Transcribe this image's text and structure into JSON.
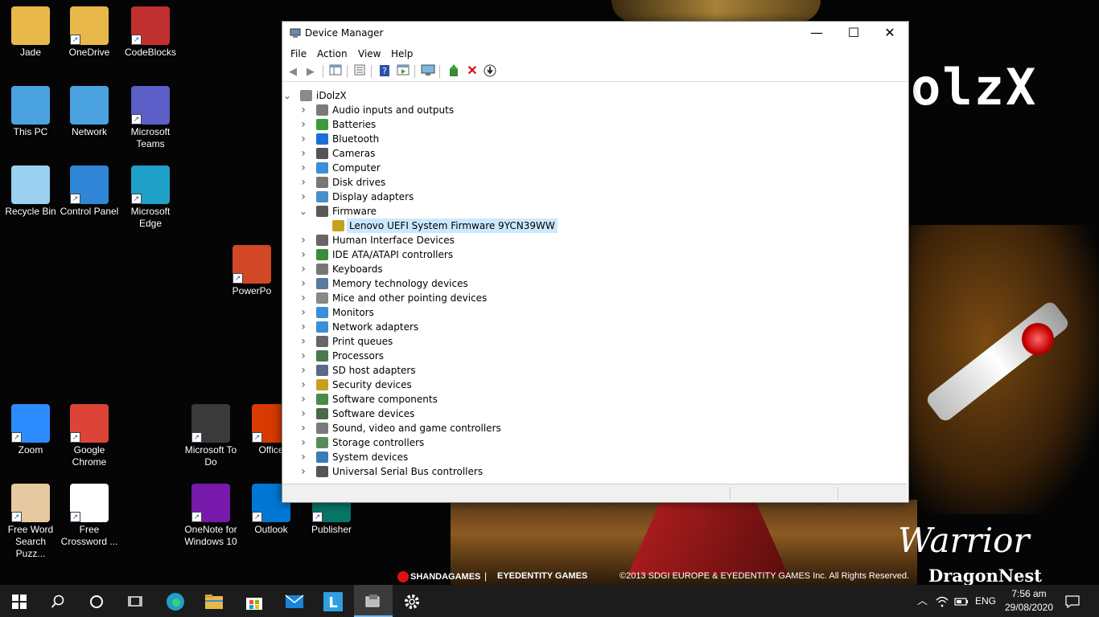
{
  "wallpaper": {
    "title": "olzX",
    "warrior": "Warrior",
    "dragonnest": "DragonNest",
    "copyright": "©2013 SDGI EUROPE & EYEDENTITY GAMES Inc. All Rights Reserved.",
    "shanda": "SHANDAGAMES",
    "separator": "|",
    "eyedentity": "EYEDENTITY GAMES"
  },
  "desktop_icons": [
    {
      "label": "Jade",
      "icon": "user-folder-icon",
      "color": "#e8b84a"
    },
    {
      "label": "OneDrive",
      "icon": "onedrive-icon",
      "color": "#e8b84a"
    },
    {
      "label": "CodeBlocks",
      "icon": "codeblocks-icon",
      "color": "#c03030"
    },
    {
      "label": "This PC",
      "icon": "this-pc-icon",
      "color": "#4aa3df"
    },
    {
      "label": "Network",
      "icon": "network-icon",
      "color": "#4aa3df"
    },
    {
      "label": "Microsoft Teams",
      "icon": "teams-icon",
      "color": "#5b5fc7"
    },
    {
      "label": "Recycle Bin",
      "icon": "recycle-bin-icon",
      "color": "#9ad0f0"
    },
    {
      "label": "Control Panel",
      "icon": "control-panel-icon",
      "color": "#2f86d6"
    },
    {
      "label": "Microsoft Edge",
      "icon": "edge-icon",
      "color": "#1fa0c8"
    },
    {
      "label": "PowerPo",
      "icon": "powerpoint-icon",
      "color": "#d24726"
    },
    {
      "label": "Zoom",
      "icon": "zoom-icon",
      "color": "#2d8cff"
    },
    {
      "label": "Google Chrome",
      "icon": "chrome-icon",
      "color": "#db4437"
    },
    {
      "label": "Microsoft To Do",
      "icon": "todo-icon",
      "color": "#3a3a3a"
    },
    {
      "label": "Office",
      "icon": "office-icon",
      "color": "#d83b01"
    },
    {
      "label": "Free Word Search Puzz...",
      "icon": "word-search-icon",
      "color": "#e6c9a0"
    },
    {
      "label": "Free Crossword ...",
      "icon": "crossword-icon",
      "color": "#ffffff"
    },
    {
      "label": "OneNote for Windows 10",
      "icon": "onenote-icon",
      "color": "#7719aa"
    },
    {
      "label": "Outlook",
      "icon": "outlook-icon",
      "color": "#0078d4"
    },
    {
      "label": "Publisher",
      "icon": "publisher-icon",
      "color": "#077568"
    }
  ],
  "window": {
    "title": "Device Manager",
    "minimize": "—",
    "maximize": "☐",
    "close": "✕",
    "menu": [
      "File",
      "Action",
      "View",
      "Help"
    ],
    "toolbar_icons": [
      "back-arrow-icon",
      "forward-arrow-icon",
      "show-hide-tree-icon",
      "properties-icon",
      "help-icon",
      "action-pane-icon",
      "monitor-icon",
      "update-driver-icon",
      "uninstall-icon",
      "download-icon"
    ],
    "root": "iDolzX",
    "categories": [
      {
        "label": "Audio inputs and outputs",
        "icon": "speaker-icon",
        "color": "#7a7a7a"
      },
      {
        "label": "Batteries",
        "icon": "battery-icon",
        "color": "#3c9a3c"
      },
      {
        "label": "Bluetooth",
        "icon": "bluetooth-icon",
        "color": "#1a6fd6"
      },
      {
        "label": "Cameras",
        "icon": "camera-icon",
        "color": "#555555"
      },
      {
        "label": "Computer",
        "icon": "computer-icon",
        "color": "#3a8fd8"
      },
      {
        "label": "Disk drives",
        "icon": "disk-icon",
        "color": "#777777"
      },
      {
        "label": "Display adapters",
        "icon": "display-adapter-icon",
        "color": "#4a90c8"
      },
      {
        "label": "Firmware",
        "icon": "firmware-icon",
        "color": "#5a5a5a",
        "expanded": true
      },
      {
        "label": "Human Interface Devices",
        "icon": "hid-icon",
        "color": "#666666"
      },
      {
        "label": "IDE ATA/ATAPI controllers",
        "icon": "ide-icon",
        "color": "#3c8c3c"
      },
      {
        "label": "Keyboards",
        "icon": "keyboard-icon",
        "color": "#777777"
      },
      {
        "label": "Memory technology devices",
        "icon": "memory-icon",
        "color": "#5a7aa0"
      },
      {
        "label": "Mice and other pointing devices",
        "icon": "mouse-icon",
        "color": "#888888"
      },
      {
        "label": "Monitors",
        "icon": "monitor-icon",
        "color": "#3a8fd8"
      },
      {
        "label": "Network adapters",
        "icon": "network-adapter-icon",
        "color": "#3a8fd8"
      },
      {
        "label": "Print queues",
        "icon": "printer-icon",
        "color": "#666666"
      },
      {
        "label": "Processors",
        "icon": "processor-icon",
        "color": "#4a7a4a"
      },
      {
        "label": "SD host adapters",
        "icon": "sd-card-icon",
        "color": "#5a6a8a"
      },
      {
        "label": "Security devices",
        "icon": "security-icon",
        "color": "#c8a020"
      },
      {
        "label": "Software components",
        "icon": "software-component-icon",
        "color": "#4a8a4a"
      },
      {
        "label": "Software devices",
        "icon": "software-device-icon",
        "color": "#4a6a4a"
      },
      {
        "label": "Sound, video and game controllers",
        "icon": "sound-icon",
        "color": "#7a7a7a"
      },
      {
        "label": "Storage controllers",
        "icon": "storage-icon",
        "color": "#5a8a5a"
      },
      {
        "label": "System devices",
        "icon": "system-device-icon",
        "color": "#3a7ab8"
      },
      {
        "label": "Universal Serial Bus controllers",
        "icon": "usb-icon",
        "color": "#555555"
      }
    ],
    "firmware_child": {
      "label": "Lenovo UEFI System Firmware 9YCN39WW",
      "icon": "firmware-warning-icon",
      "color": "#c8a020"
    }
  },
  "taskbar": {
    "items": [
      "start-icon",
      "search-icon",
      "cortana-icon",
      "task-view-icon",
      "edge-icon",
      "file-explorer-icon",
      "store-icon",
      "mail-icon",
      "lenovo-l-icon",
      "device-manager-icon",
      "settings-icon"
    ],
    "active": "device-manager-icon",
    "language": "ENG",
    "time": "7:56 am",
    "date": "29/08/2020"
  }
}
